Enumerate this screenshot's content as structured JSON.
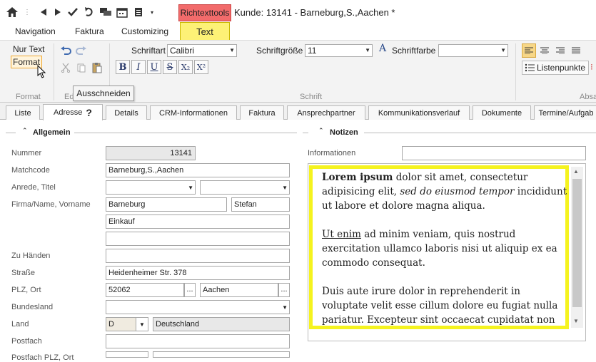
{
  "titlebar": {
    "context_tab": "Richtexttools",
    "title": "Kunde: 13141 - Barneburg,S.,Aachen *"
  },
  "menu": {
    "items": [
      "Navigation",
      "Faktura",
      "Customizing"
    ],
    "text_tab": "Text"
  },
  "ribbon": {
    "nur_text": "Nur Text",
    "format": "Format",
    "format_group": "Format",
    "edit_group": "Ed",
    "schrift_group": "Schrift",
    "absatz_group": "Absa",
    "font_label": "Schriftart",
    "font_value": "Calibri",
    "size_label": "Schriftgröße",
    "size_value": "11",
    "color_label": "Schriftfarbe",
    "color_value": "",
    "bold": "B",
    "italic": "I",
    "underline": "U",
    "strike": "S",
    "sub": "X₂",
    "sup": "X²",
    "list_label": "Listenpunkte"
  },
  "tooltip": "Ausschneiden",
  "tabs": [
    "Liste",
    "Adresse",
    "Details",
    "CRM-Informationen",
    "Faktura",
    "Ansprechpartner",
    "Kommunikationsverlauf",
    "Dokumente",
    "Termine/Aufgab"
  ],
  "sections": {
    "allgemein": "Allgemein",
    "notizen": "Notizen"
  },
  "form": {
    "nummer_label": "Nummer",
    "nummer": "13141",
    "matchcode_label": "Matchcode",
    "matchcode": "Barneburg,S.,Aachen",
    "anrede_label": "Anrede, Titel",
    "firma_label": "Firma/Name, Vorname",
    "firma": "Barneburg",
    "vorname": "Stefan",
    "firma2": "Einkauf",
    "zuhaenden_label": "Zu Händen",
    "strasse_label": "Straße",
    "strasse": "Heidenheimer Str. 378",
    "plz_label": "PLZ, Ort",
    "plz": "52062",
    "ort": "Aachen",
    "bundesland_label": "Bundesland",
    "land_label": "Land",
    "land_code": "D",
    "land_name": "Deutschland",
    "postfach_label": "Postfach",
    "postfach_plz_label": "Postfach PLZ, Ort",
    "dots": "..."
  },
  "notizen": {
    "informationen_label": "Informationen",
    "p1_bold": "Lorem ipsum",
    "p1_a": " dolor sit amet, consectetur adipisicing elit, ",
    "p1_italic": "sed do eiusmod tempor",
    "p1_b": " incididunt ut labore et dolore magna aliqua.",
    "p2_underline": "Ut enim",
    "p2_a": " ad minim veniam, quis nostrud exercitation ullamco laboris nisi ut aliquip ex ea commodo consequat.",
    "p3": "Duis aute irure dolor in reprehenderit in voluptate velit esse cillum dolore eu fugiat nulla pariatur. Excepteur sint occaecat cupidatat non proident, sunt"
  },
  "colors": {
    "context_red": "#f26b6b",
    "text_tab_yellow": "#fdf176",
    "highlight_yellow": "#f5f31f"
  }
}
